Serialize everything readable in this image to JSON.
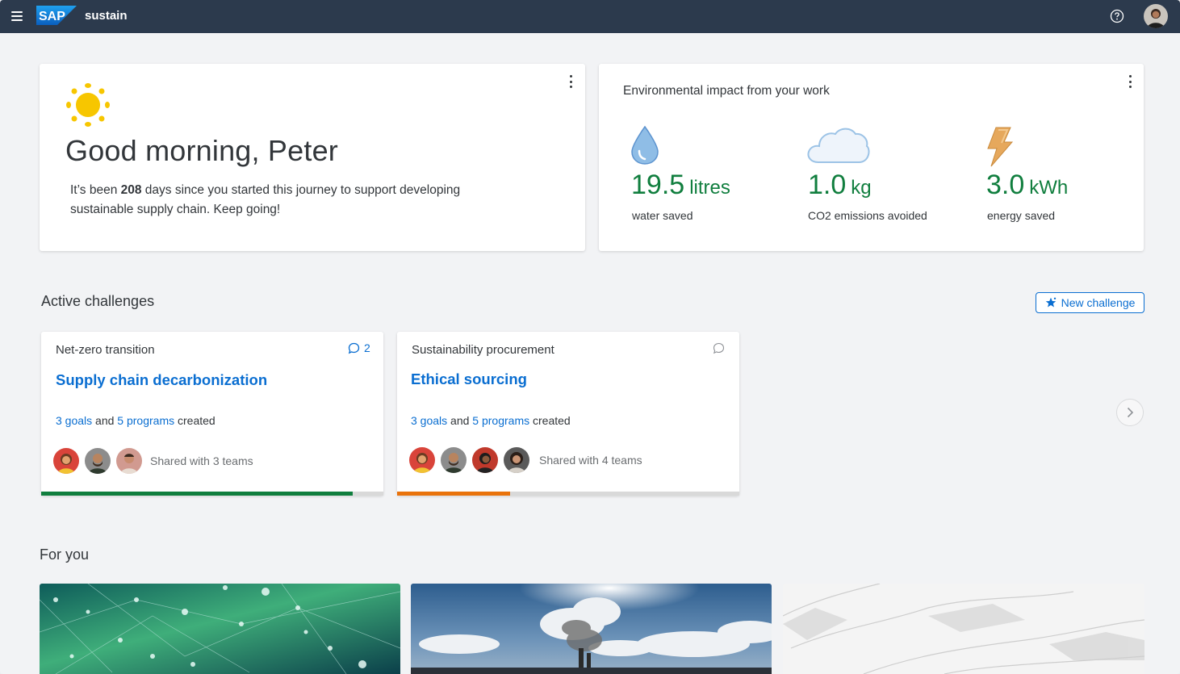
{
  "shell": {
    "product": "sustain",
    "logo_text": "SAP"
  },
  "greeting_card": {
    "greeting": "Good morning, Peter",
    "journey_pre": "It’s been ",
    "journey_days": "208",
    "journey_post": " days since you started this journey to support developing sustainable supply chain. Keep going!"
  },
  "impact_card": {
    "title": "Environmental impact from your work",
    "metrics": [
      {
        "value": "19.5",
        "unit": "litres",
        "label": "water saved",
        "icon": "water-drop-icon"
      },
      {
        "value": "1.0",
        "unit": "kg",
        "label": "CO2 emissions avoided",
        "icon": "cloud-icon"
      },
      {
        "value": "3.0",
        "unit": "kWh",
        "label": "energy saved",
        "icon": "lightning-icon"
      }
    ]
  },
  "challenges": {
    "title": "Active challenges",
    "new_button": "New challenge",
    "items": [
      {
        "category": "Net-zero transition",
        "title": "Supply chain decarbonization",
        "goals": "3 goals",
        "and": "and",
        "programs": "5 programs",
        "created": "created",
        "shared": "Shared with 3 teams",
        "comments": "2",
        "progress": 0.91,
        "progress_color": "#107e3e"
      },
      {
        "category": "Sustainability procurement",
        "title": "Ethical sourcing",
        "goals": "3 goals",
        "and": "and",
        "programs": "5 programs",
        "created": "created",
        "shared": "Shared with 4 teams",
        "comments": "",
        "progress": 0.33,
        "progress_color": "#e9730c"
      }
    ]
  },
  "for_you": {
    "title": "For you"
  },
  "colors": {
    "shell": "#2c3a4d",
    "link": "#0a6ed1",
    "positive": "#107e3e"
  }
}
